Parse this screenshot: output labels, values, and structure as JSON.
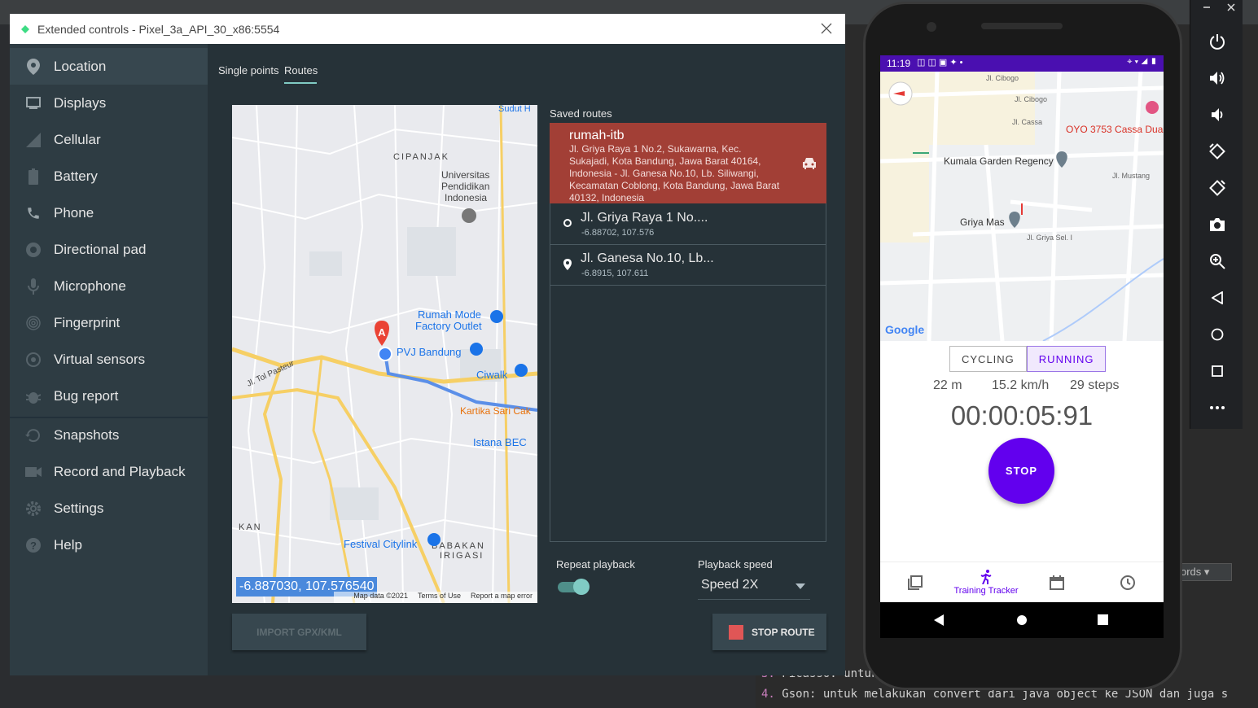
{
  "window": {
    "title": "Extended controls - Pixel_3a_API_30_x86:5554"
  },
  "sidebar": {
    "items": [
      {
        "label": "Location",
        "icon": "location-pin-icon"
      },
      {
        "label": "Displays",
        "icon": "display-icon"
      },
      {
        "label": "Cellular",
        "icon": "cellular-signal-icon"
      },
      {
        "label": "Battery",
        "icon": "battery-icon"
      },
      {
        "label": "Phone",
        "icon": "phone-icon"
      },
      {
        "label": "Directional pad",
        "icon": "dpad-icon"
      },
      {
        "label": "Microphone",
        "icon": "microphone-icon"
      },
      {
        "label": "Fingerprint",
        "icon": "fingerprint-icon"
      },
      {
        "label": "Virtual sensors",
        "icon": "virtual-sensors-icon"
      },
      {
        "label": "Bug report",
        "icon": "bug-icon"
      },
      {
        "label": "Snapshots",
        "icon": "snapshots-icon"
      },
      {
        "label": "Record and Playback",
        "icon": "video-camera-icon"
      },
      {
        "label": "Settings",
        "icon": "gear-icon"
      },
      {
        "label": "Help",
        "icon": "help-icon"
      }
    ]
  },
  "tabs": {
    "single_points": "Single points",
    "routes": "Routes"
  },
  "map": {
    "coordinate": "-6.887030, 107.576540",
    "labels": {
      "cipanjak": "CIPANJAK",
      "univ": "Universitas Pendidikan Indonesia",
      "rumah_mode": "Rumah Mode Factory Outlet",
      "pvj": "PVJ Bandung",
      "ciwalk": "Ciwalk",
      "kartika": "Kartika Sari Cak",
      "istana": "Istana BEC",
      "festival": "Festival Citylink",
      "babakan": "BABAKAN IRIGASI",
      "tol": "Jl. Tol Pasteur",
      "sudut": "Sudut H",
      "kan": "KAN",
      "marker": "A"
    },
    "footer": {
      "data": "Map data ©2021",
      "terms": "Terms of Use",
      "report": "Report a map error"
    }
  },
  "routes": {
    "saved_label": "Saved routes",
    "selected": {
      "name": "rumah-itb",
      "address": "Jl. Griya Raya 1 No.2, Sukawarna, Kec. Sukajadi, Kota Bandung, Jawa Barat 40164, Indonesia - Jl. Ganesa No.10, Lb. Siliwangi, Kecamatan Coblong, Kota Bandung, Jawa Barat 40132, Indonesia"
    },
    "waypoints": [
      {
        "title": "Jl. Griya Raya 1 No....",
        "coords": "-6.88702, 107.576"
      },
      {
        "title": "Jl. Ganesa No.10, Lb...",
        "coords": "-6.8915, 107.611"
      }
    ]
  },
  "options": {
    "repeat_label": "Repeat playback",
    "repeat_on": true,
    "speed_label": "Playback speed",
    "speed_value": "Speed 2X"
  },
  "buttons": {
    "import": "IMPORT GPX/KML",
    "stop_route": "STOP ROUTE"
  },
  "phone": {
    "status_time": "11:19",
    "map_labels": {
      "oyo": "OYO 3753 Cassa Dua",
      "kumala": "Kumala Garden Regency",
      "griya": "Griya Mas",
      "cibogo": "Jl. Cibogo",
      "cassa": "Jl. Cassa",
      "mustang": "Jl. Mustang",
      "sel": "Jl. Griya Sel. I",
      "google": "Google"
    },
    "modes": {
      "cycling": "CYCLING",
      "running": "RUNNING"
    },
    "stats": {
      "distance": "22 m",
      "speed": "15.2 km/h",
      "steps": "29 steps"
    },
    "timer": "00:00:05:91",
    "stop_label": "STOP",
    "nav": {
      "tracker": "Training Tracker"
    }
  },
  "ide": {
    "console_line3_num": "3.",
    "console_line3": "Picasso: untuk melakukan chaci",
    "console_line4_num": "4.",
    "console_line4": "Gson: untuk melakukan convert dari java object ke JSON dan juga s",
    "words_dropdown": "ords"
  },
  "colors": {
    "accent": "#80cbc4",
    "selected_route": "#a23f36",
    "phone_primary": "#6200ee"
  }
}
